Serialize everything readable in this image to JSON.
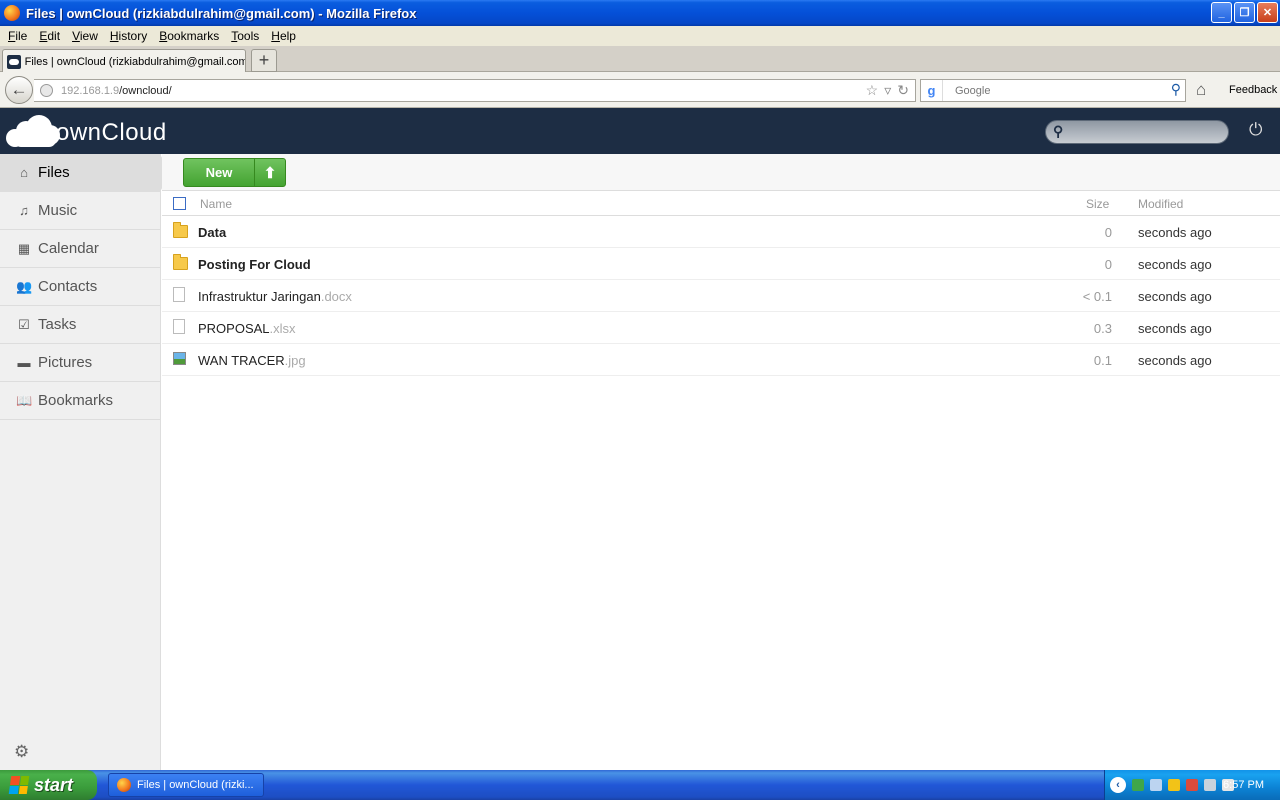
{
  "window": {
    "title": "Files | ownCloud (rizkiabdulrahim@gmail.com) - Mozilla Firefox"
  },
  "menu": [
    {
      "label": "File",
      "accel": "F",
      "rest": "ile"
    },
    {
      "label": "Edit",
      "accel": "E",
      "rest": "dit"
    },
    {
      "label": "View",
      "accel": "V",
      "rest": "iew"
    },
    {
      "label": "History",
      "accel": "H",
      "rest": "istory"
    },
    {
      "label": "Bookmarks",
      "accel": "B",
      "rest": "ookmarks"
    },
    {
      "label": "Tools",
      "accel": "T",
      "rest": "ools"
    },
    {
      "label": "Help",
      "accel": "H",
      "rest": "elp"
    }
  ],
  "tab": {
    "label": "Files | ownCloud (rizkiabdulrahim@gmail.com)",
    "new_tab_label": "+"
  },
  "address": {
    "host": "192.168.1.9",
    "path": "/owncloud/"
  },
  "search": {
    "placeholder": "Google"
  },
  "toolbar": {
    "feedback_label": "Feedback"
  },
  "owncloud": {
    "wordmark": "ownCloud",
    "nav": [
      {
        "label": "Files",
        "icon": "home-icon",
        "glyph": "⌂",
        "active": true
      },
      {
        "label": "Music",
        "icon": "music-icon",
        "glyph": "♫",
        "active": false
      },
      {
        "label": "Calendar",
        "icon": "calendar-icon",
        "glyph": "▦",
        "active": false
      },
      {
        "label": "Contacts",
        "icon": "contacts-icon",
        "glyph": "👥",
        "active": false
      },
      {
        "label": "Tasks",
        "icon": "tasks-icon",
        "glyph": "☑",
        "active": false
      },
      {
        "label": "Pictures",
        "icon": "pictures-icon",
        "glyph": "▬",
        "active": false
      },
      {
        "label": "Bookmarks",
        "icon": "bookmarks-icon",
        "glyph": "📖",
        "active": false
      }
    ],
    "new_button_label": "New",
    "columns": {
      "name": "Name",
      "size": "Size",
      "modified": "Modified"
    },
    "files": [
      {
        "name": "Data",
        "ext": "",
        "type": "folder",
        "size": "0",
        "modified": "seconds ago"
      },
      {
        "name": "Posting For Cloud",
        "ext": "",
        "type": "folder",
        "size": "0",
        "modified": "seconds ago"
      },
      {
        "name": "Infrastruktur Jaringan",
        "ext": ".docx",
        "type": "doc",
        "size": "< 0.1",
        "modified": "seconds ago"
      },
      {
        "name": "PROPOSAL",
        "ext": ".xlsx",
        "type": "doc",
        "size": "0.3",
        "modified": "seconds ago"
      },
      {
        "name": "WAN TRACER",
        "ext": ".jpg",
        "type": "img",
        "size": "0.1",
        "modified": "seconds ago"
      }
    ]
  },
  "taskbar": {
    "start_label": "start",
    "task_label": "Files | ownCloud (rizki...",
    "clock": "6:57 PM"
  },
  "colors": {
    "oc_header": "#1d2d44",
    "new_button": "#44a331",
    "xp_blue": "#0550d8"
  }
}
